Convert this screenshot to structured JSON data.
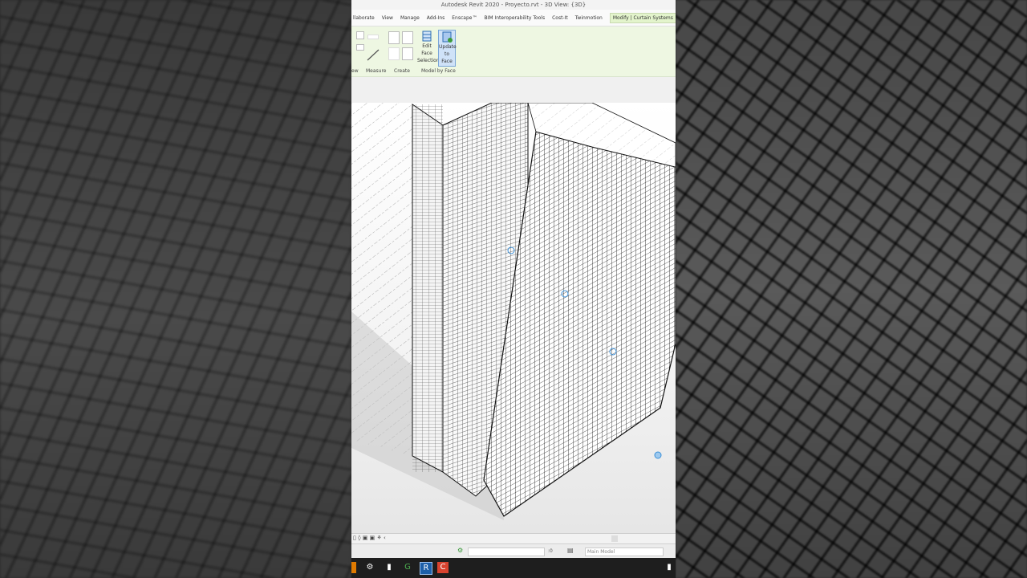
{
  "window": {
    "title": "Autodesk Revit 2020 - Proyecto.rvt - 3D View: {3D}"
  },
  "tabs": [
    "llaborate",
    "View",
    "Manage",
    "Add-Ins",
    "Enscape™",
    "BIM Interoperability Tools",
    "Cost-It",
    "Twinmotion",
    "Modify | Curtain Systems"
  ],
  "ribbon": {
    "panels": {
      "view": "ew",
      "measure": "Measure",
      "create": "Create",
      "model_by_face": "Model by Face"
    },
    "tools": {
      "edit_face_selection": [
        "Edit Face",
        "Selection"
      ],
      "update_to_face": [
        "Update",
        "to Face"
      ]
    }
  },
  "statusbar": {
    "level": ":0",
    "model": "Main Model"
  },
  "colors": {
    "ribbon_bg": "#eef7e2",
    "active_tool": "#cfe2f8",
    "grid_line": "#222222",
    "selection_blue": "#3a8fd8"
  },
  "icons": [
    "settings-icon",
    "file-icon",
    "google-icon",
    "revit-icon",
    "app-icon",
    "mouse-icon"
  ]
}
